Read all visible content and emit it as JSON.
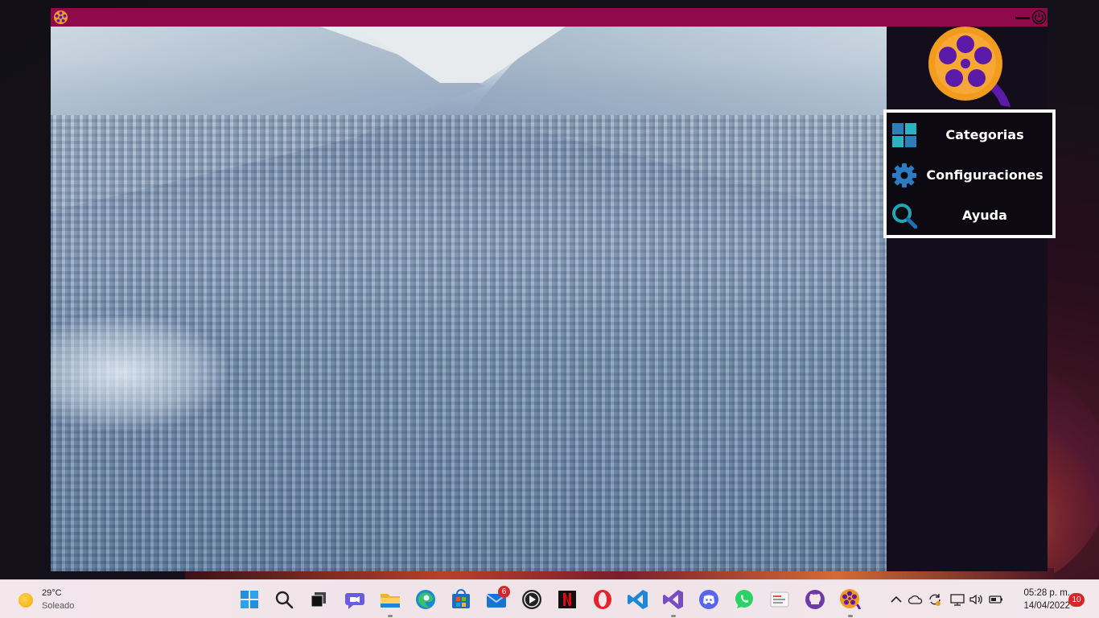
{
  "app": {
    "menu": {
      "items": [
        {
          "label": "Categorias",
          "icon": "grid-icon"
        },
        {
          "label": "Configuraciones",
          "icon": "gear-icon"
        },
        {
          "label": "Ayuda",
          "icon": "search-icon"
        }
      ]
    },
    "colors": {
      "titlebar": "#8e0a4a",
      "background": "#140d1c",
      "menu_border": "#ffffff",
      "logo_orange": "#f39b1f",
      "logo_purple": "#5b1aa8"
    }
  },
  "taskbar": {
    "weather": {
      "temperature": "29°C",
      "condition": "Soleado",
      "icon": "sun-icon"
    },
    "apps": [
      {
        "name": "start-icon"
      },
      {
        "name": "search-icon"
      },
      {
        "name": "task-view-icon"
      },
      {
        "name": "chat-icon"
      },
      {
        "name": "file-explorer-icon",
        "running": true
      },
      {
        "name": "edge-icon"
      },
      {
        "name": "store-icon"
      },
      {
        "name": "mail-icon",
        "badge": "6"
      },
      {
        "name": "media-player-icon"
      },
      {
        "name": "netflix-icon"
      },
      {
        "name": "opera-icon"
      },
      {
        "name": "vscode-icon"
      },
      {
        "name": "visual-studio-icon",
        "running": true
      },
      {
        "name": "discord-icon"
      },
      {
        "name": "whatsapp-icon"
      },
      {
        "name": "notes-app-icon"
      },
      {
        "name": "github-icon"
      },
      {
        "name": "movie-app-icon",
        "running": true
      }
    ],
    "tray": [
      {
        "name": "chevron-up-icon"
      },
      {
        "name": "onedrive-icon"
      },
      {
        "name": "sync-icon"
      },
      {
        "name": "network-icon"
      },
      {
        "name": "volume-icon"
      },
      {
        "name": "battery-icon"
      }
    ],
    "clock": {
      "time": "05:28 p. m.",
      "date": "14/04/2022"
    },
    "notifications": "10"
  }
}
